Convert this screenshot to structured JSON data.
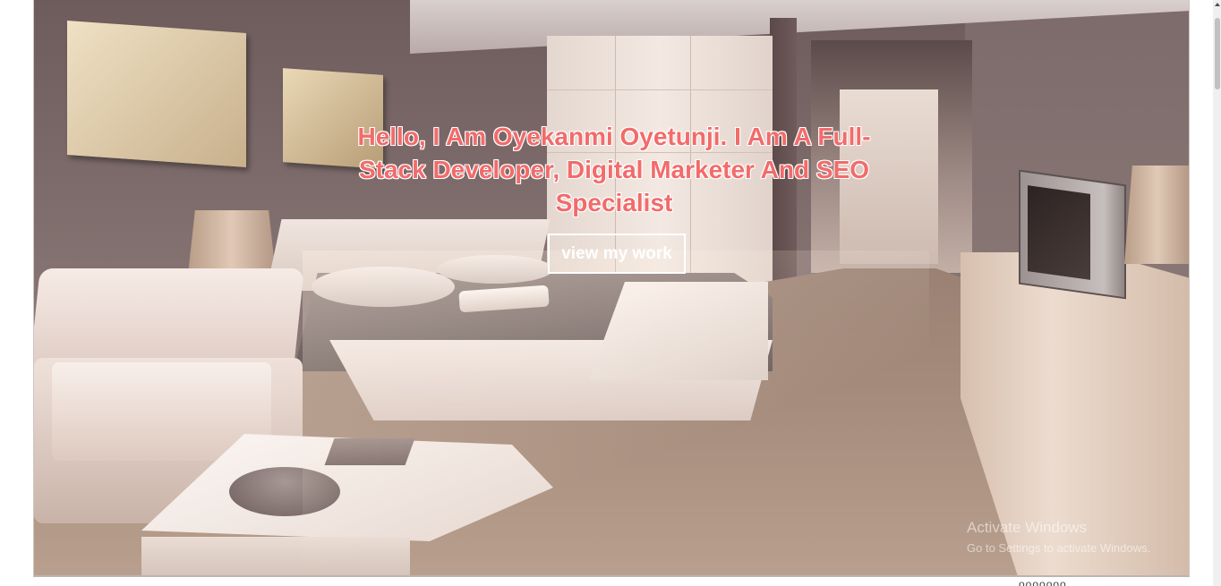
{
  "hero": {
    "headline": "Hello, I Am Oyekanmi Oyetunji. I Am A Full-Stack Developer, Digital Marketer And SEO Specialist",
    "cta_label": "view my work",
    "headline_color": "#f26b6b",
    "cta_color": "#ffffff"
  },
  "watermark": {
    "title": "Activate Windows",
    "subtitle": "Go to Settings to activate Windows."
  },
  "footer_fragment": "ooooooo"
}
